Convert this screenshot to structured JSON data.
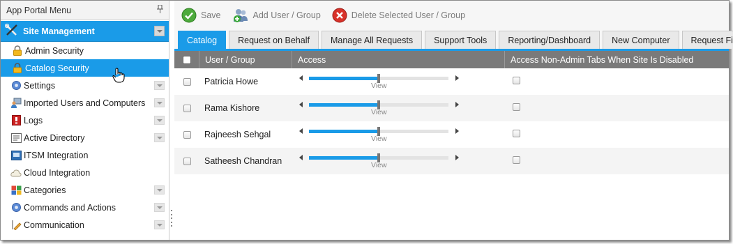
{
  "sidebar": {
    "title": "App Portal Menu",
    "pin_glyph": "ф",
    "section": {
      "label": "Site Management",
      "icon": "tools-icon"
    },
    "items": [
      {
        "label": "Admin Security",
        "icon": "lock-icon",
        "expandable": false,
        "active": false
      },
      {
        "label": "Catalog Security",
        "icon": "lock-icon",
        "expandable": false,
        "active": true
      },
      {
        "label": "Settings",
        "icon": "gear-icon",
        "expandable": true
      },
      {
        "label": "Imported Users and Computers",
        "icon": "users-computer-icon",
        "expandable": true
      },
      {
        "label": "Logs",
        "icon": "log-book-icon",
        "expandable": true
      },
      {
        "label": "Active Directory",
        "icon": "directory-icon",
        "expandable": true
      },
      {
        "label": "ITSM Integration",
        "icon": "itsm-icon",
        "expandable": false
      },
      {
        "label": "Cloud Integration",
        "icon": "cloud-icon",
        "expandable": false
      },
      {
        "label": "Categories",
        "icon": "folder-icon",
        "expandable": true
      },
      {
        "label": "Commands and Actions",
        "icon": "gear-icon",
        "expandable": true
      },
      {
        "label": "Communication",
        "icon": "communication-icon",
        "expandable": true
      }
    ]
  },
  "toolbar": {
    "save_label": "Save",
    "add_label": "Add User / Group",
    "delete_label": "Delete Selected User / Group"
  },
  "tabs": [
    {
      "label": "Catalog",
      "active": true
    },
    {
      "label": "Request on Behalf"
    },
    {
      "label": "Manage All Requests"
    },
    {
      "label": "Support Tools"
    },
    {
      "label": "Reporting/Dashboard"
    },
    {
      "label": "New Computer"
    },
    {
      "label": "Request Filters"
    }
  ],
  "grid": {
    "columns": {
      "user": "User / Group",
      "access": "Access",
      "nonadmin": "Access Non-Admin Tabs When Site Is Disabled"
    },
    "rows": [
      {
        "name": "Patricia Howe",
        "access_label": "View",
        "access_level": 0.5,
        "nonadmin": false
      },
      {
        "name": "Rama Kishore",
        "access_label": "View",
        "access_level": 0.5,
        "nonadmin": false
      },
      {
        "name": "Rajneesh Sehgal",
        "access_label": "View",
        "access_level": 0.5,
        "nonadmin": false
      },
      {
        "name": "Satheesh Chandran",
        "access_label": "View",
        "access_level": 0.5,
        "nonadmin": false
      }
    ]
  },
  "colors": {
    "accent": "#1a9be8",
    "grid_header": "#7a7a7a"
  }
}
